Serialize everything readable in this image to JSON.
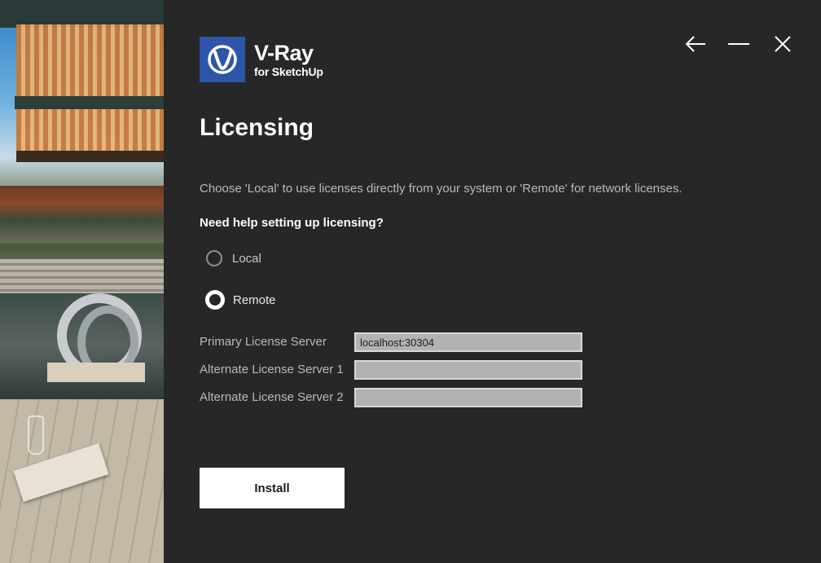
{
  "app": {
    "logo_title": "V-Ray",
    "logo_subtitle": "for SketchUp",
    "brand_color": "#2e55a7"
  },
  "window_controls": {
    "back_icon": "arrow-left-icon",
    "minimize_icon": "minimize-icon",
    "close_icon": "close-icon"
  },
  "page": {
    "title": "Licensing",
    "description": "Choose 'Local' to use licenses directly from your system or 'Remote' for network licenses.",
    "help_link": "Need help setting up licensing?"
  },
  "license_mode": {
    "options": [
      {
        "label": "Local",
        "selected": false
      },
      {
        "label": "Remote",
        "selected": true
      }
    ]
  },
  "servers": {
    "primary_label": "Primary License Server",
    "primary_value": "localhost:30304",
    "alternate1_label": "Alternate License Server 1",
    "alternate1_value": "",
    "alternate2_label": "Alternate License Server 2",
    "alternate2_value": ""
  },
  "actions": {
    "install_label": "Install"
  }
}
